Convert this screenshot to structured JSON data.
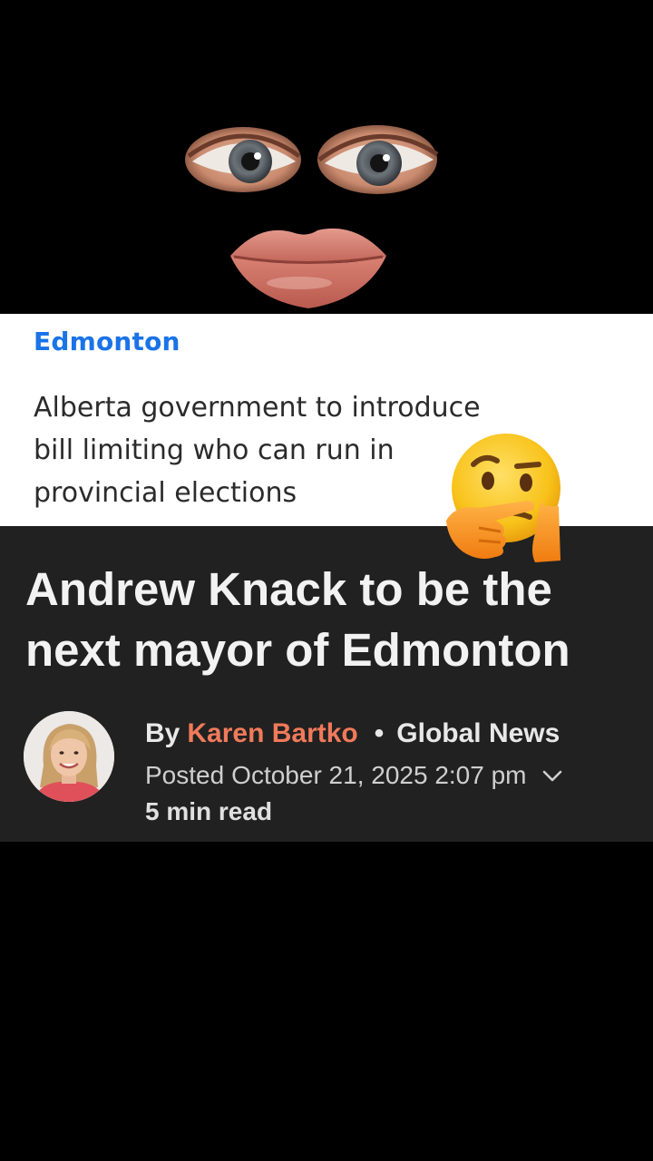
{
  "headline_card": {
    "category": "Edmonton",
    "lines": [
      "Alberta government to introduce",
      "bill limiting who can run in",
      "provincial elections"
    ]
  },
  "overlay": {
    "emoji": "thinking-face-icon"
  },
  "article": {
    "title_lines": [
      "Andrew Knack to be the",
      "next mayor of Edmonton"
    ],
    "byline_prefix": "By",
    "author": "Karen Bartko",
    "separator": "•",
    "publisher": "Global News",
    "posted_label": "Posted",
    "posted_date": "October 21, 2025 2:07 pm",
    "read_time": "5 min read"
  },
  "colors": {
    "category": "#1a73e8",
    "author": "#f07a5a",
    "article_bg": "#212121"
  }
}
